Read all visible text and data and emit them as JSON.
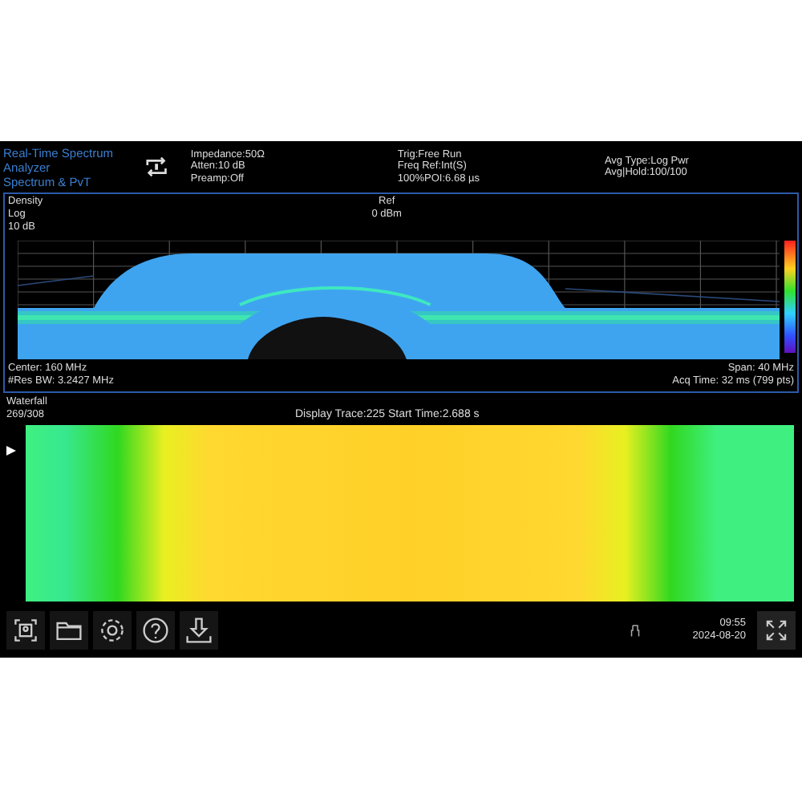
{
  "mode": {
    "title": "Real-Time Spectrum Analyzer",
    "subtitle": "Spectrum & PvT"
  },
  "status": [
    [
      "Impedance:50Ω",
      "Atten:10 dB",
      "Preamp:Off"
    ],
    [
      "Trig:Free Run",
      "Freq Ref:Int(S)",
      "100%POI:6.68 µs"
    ],
    [
      "Avg Type:Log Pwr",
      "Avg|Hold:100/100"
    ]
  ],
  "density": {
    "title": "Density",
    "scale": "Log",
    "div": "10 dB",
    "ref_label": "Ref",
    "ref_value": "0 dBm",
    "center": "Center: 160 MHz",
    "res_bw": "#Res BW: 3.2427 MHz",
    "span": "Span: 40 MHz",
    "acq_time": "Acq Time: 32 ms (799 pts)"
  },
  "waterfall": {
    "title": "Waterfall",
    "count": "269/308",
    "trace_info": "Display Trace:225  Start Time:2.688 s"
  },
  "toolbar": {
    "time": "09:55",
    "date": "2024-08-20"
  }
}
